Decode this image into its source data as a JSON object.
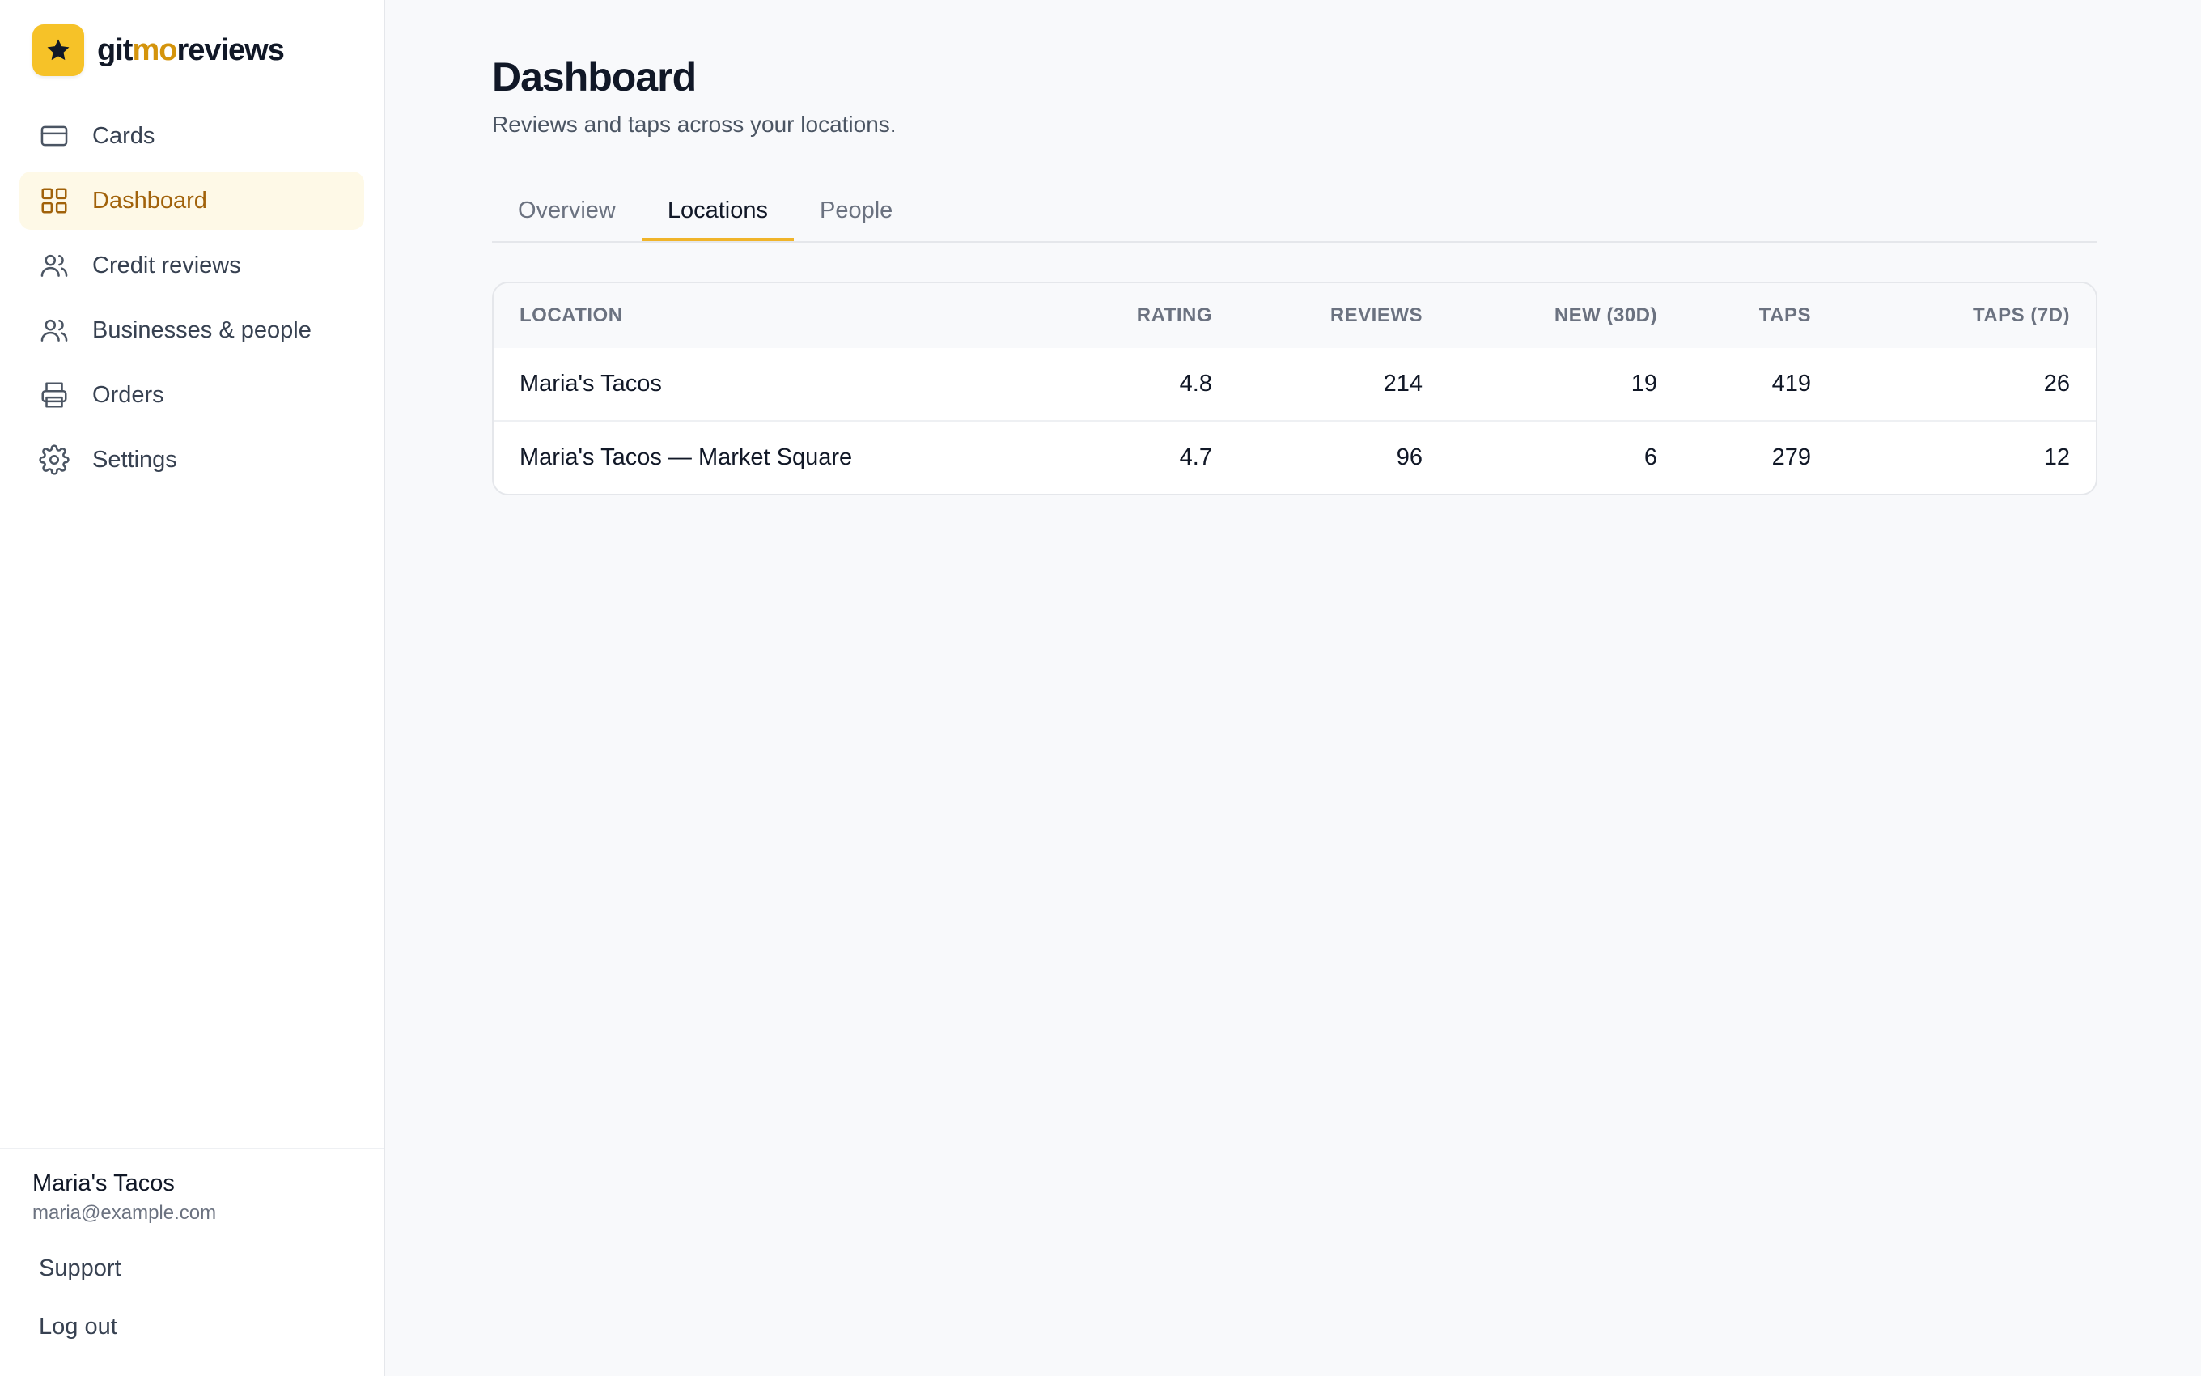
{
  "brand": {
    "prefix": "git",
    "highlight": "mo",
    "suffix": "reviews",
    "accent_color": "#f6c228",
    "icon": "star-icon"
  },
  "sidebar": {
    "items": [
      {
        "label": "Cards",
        "icon": "credit-card-icon",
        "active": false
      },
      {
        "label": "Dashboard",
        "icon": "grid-icon",
        "active": true
      },
      {
        "label": "Credit reviews",
        "icon": "users-icon",
        "active": false
      },
      {
        "label": "Businesses & people",
        "icon": "users-icon",
        "active": false
      },
      {
        "label": "Orders",
        "icon": "printer-icon",
        "active": false
      },
      {
        "label": "Settings",
        "icon": "gear-icon",
        "active": false
      }
    ],
    "account": {
      "name": "Maria's Tacos",
      "email": "maria@example.com"
    },
    "footer_links": {
      "support": "Support",
      "logout": "Log out"
    }
  },
  "main": {
    "title": "Dashboard",
    "subtitle": "Reviews and taps across your locations.",
    "tabs": [
      {
        "label": "Overview",
        "active": false
      },
      {
        "label": "Locations",
        "active": true
      },
      {
        "label": "People",
        "active": false
      }
    ],
    "table": {
      "headers": [
        "LOCATION",
        "RATING",
        "REVIEWS",
        "NEW (30D)",
        "TAPS",
        "TAPS (7D)"
      ],
      "rows": [
        [
          "Maria's Tacos",
          "4.8",
          "214",
          "19",
          "419",
          "26"
        ],
        [
          "Maria's Tacos — Market Square",
          "4.7",
          "96",
          "6",
          "279",
          "12"
        ]
      ]
    }
  },
  "colors": {
    "active_text": "#a1620a",
    "active_bg": "#fef9e7",
    "tab_underline": "#f0b429"
  }
}
